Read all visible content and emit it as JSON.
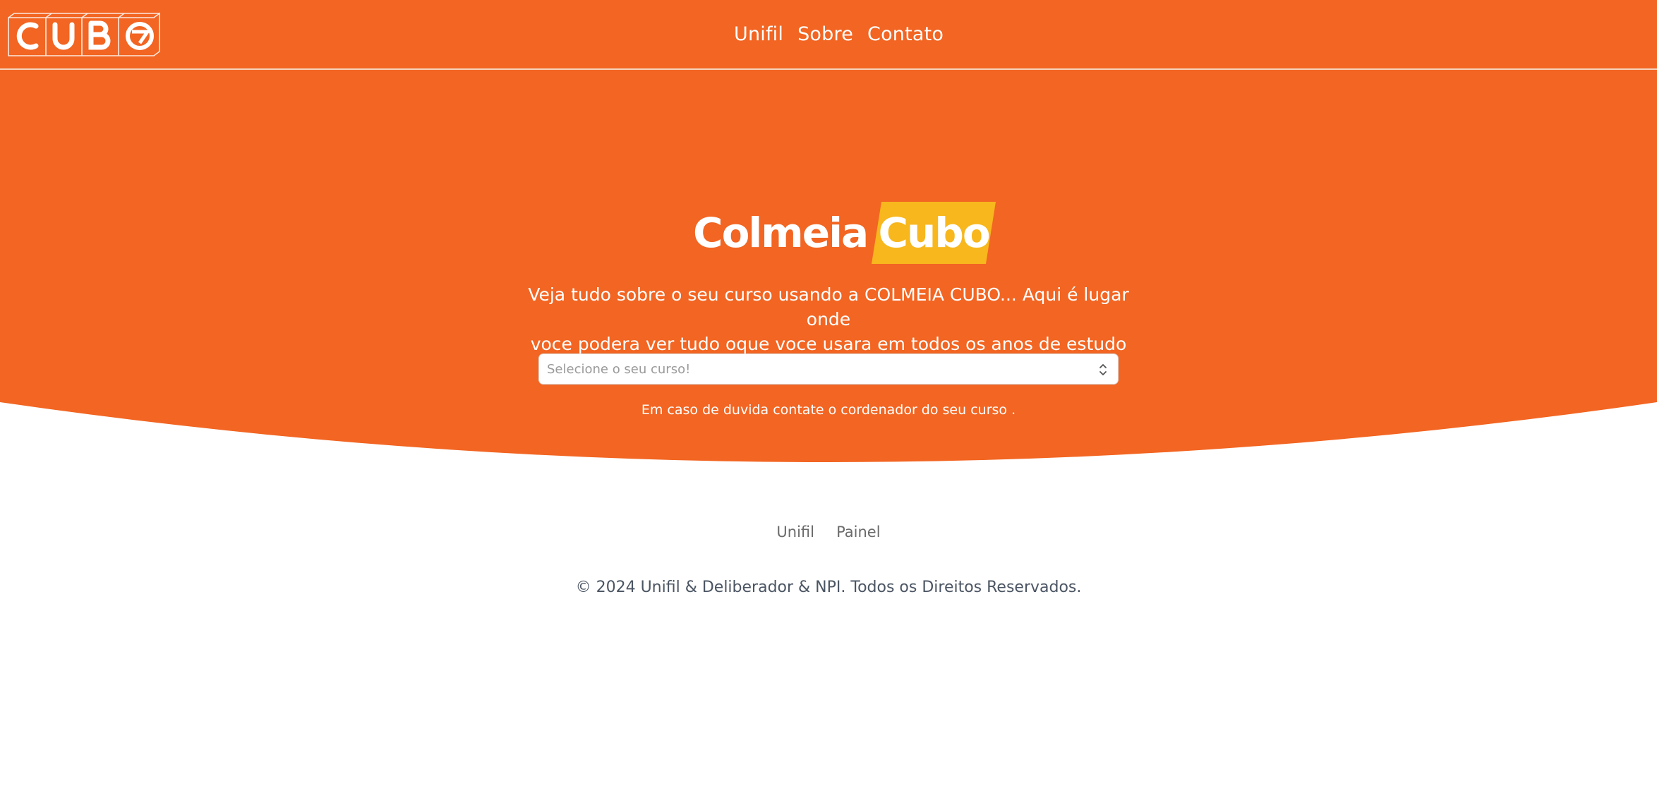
{
  "colors": {
    "primary_orange": "#f26522",
    "brand_yellow": "#f7b71d",
    "white": "#ffffff",
    "footer_text": "#4b5563"
  },
  "header": {
    "logo_text": "CUBO",
    "nav": [
      {
        "label": "Unifil"
      },
      {
        "label": "Sobre"
      },
      {
        "label": "Contato"
      }
    ]
  },
  "hero": {
    "brand_left": "Colmeia",
    "brand_right": "Cubo",
    "tagline_line1": "Veja tudo sobre o seu curso usando a COLMEIA CUBO... Aqui é lugar onde",
    "tagline_line2": "voce podera ver tudo oque voce usara em todos os anos de estudo",
    "course_select": {
      "placeholder": "Selecione o seu curso!",
      "icon": "chevron-up-down-icon"
    },
    "help_text": "Em caso de duvida contate o cordenador do seu curso ."
  },
  "footer": {
    "links": [
      {
        "label": "Unifil"
      },
      {
        "label": "Painel"
      }
    ],
    "copyright": "© 2024 Unifil & Deliberador & NPI. Todos os Direitos Reservados."
  }
}
